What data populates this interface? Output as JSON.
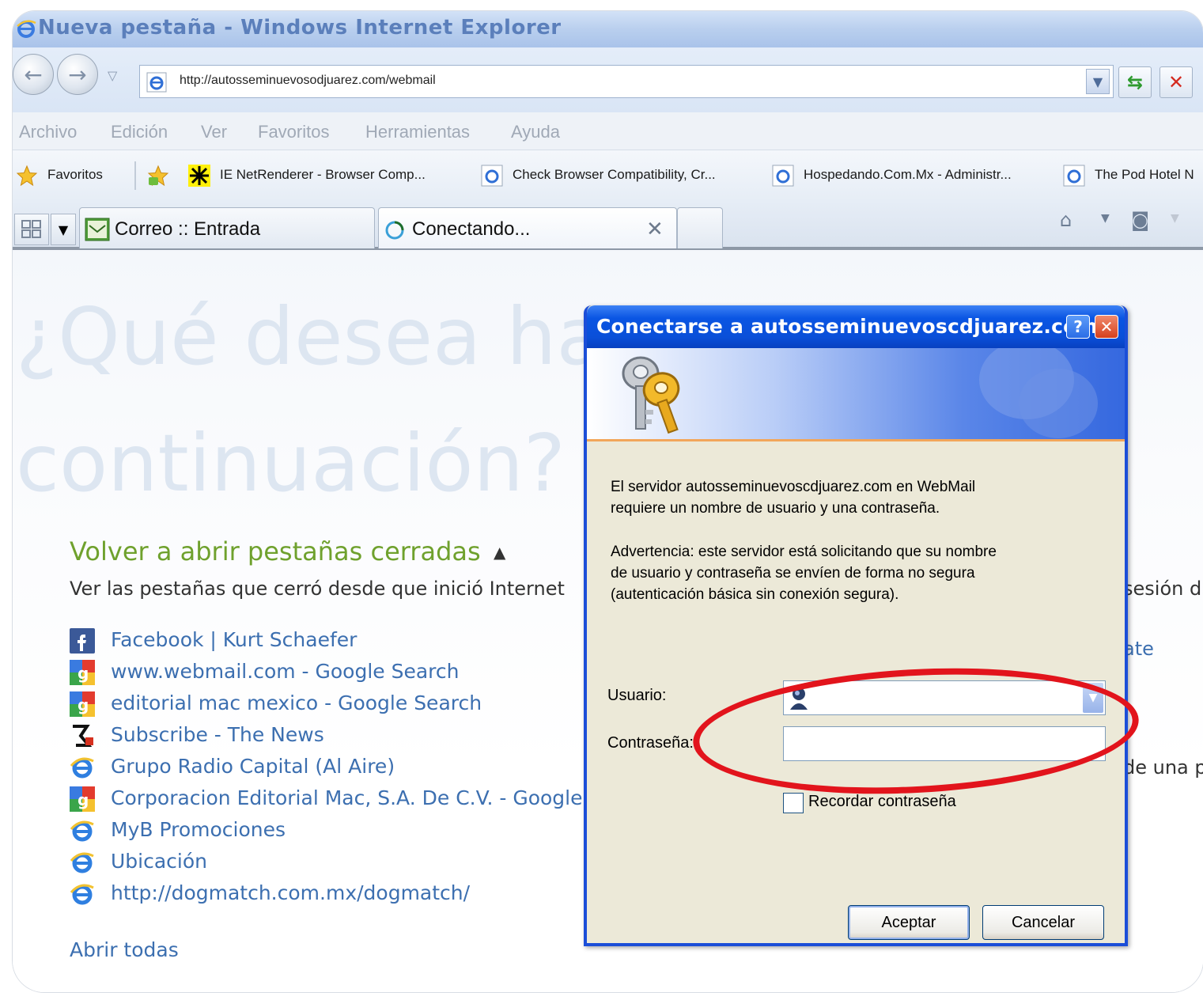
{
  "window": {
    "title": "Nueva pestaña - Windows Internet Explorer"
  },
  "address_bar": {
    "url": "http://autosseminuevosodjuarez.com/webmail",
    "refresh_icon": "refresh-icon",
    "stop_icon": "stop-icon"
  },
  "menu": {
    "items": [
      "Archivo",
      "Edición",
      "Ver",
      "Favoritos",
      "Herramientas",
      "Ayuda"
    ]
  },
  "favorites_bar": {
    "favorites_label": "Favoritos",
    "links": [
      "IE NetRenderer - Browser Comp...",
      "Check Browser Compatibility, Cr...",
      "Hospedando.Com.Mx - Administr...",
      "The Pod Hotel N"
    ]
  },
  "tabs": [
    {
      "label": "Correo :: Entrada"
    },
    {
      "label": "Conectando..."
    }
  ],
  "new_tab_page": {
    "heading": "¿Qué desea hacer a continuación?",
    "reopen_title": "Volver a abrir pestañas cerradas",
    "reopen_desc": "Ver las pestañas que cerró desde que inició Internet",
    "right_desc": "sesión d",
    "right_link": "ate",
    "right_text2": "de una p",
    "closed_tabs": [
      {
        "label": "Facebook | Kurt Schaefer",
        "icon": "facebook-icon"
      },
      {
        "label": "www.webmail.com - Google Search",
        "icon": "google-icon"
      },
      {
        "label": "editorial mac mexico - Google Search",
        "icon": "google-icon"
      },
      {
        "label": "Subscribe - The News",
        "icon": "feed-icon"
      },
      {
        "label": "Grupo Radio Capital (Al Aire)",
        "icon": "ie-icon"
      },
      {
        "label": "Corporacion Editorial Mac, S.A. De C.V. - Google",
        "icon": "google-icon"
      },
      {
        "label": "MyB Promociones",
        "icon": "ie-icon"
      },
      {
        "label": "Ubicación",
        "icon": "ie-icon"
      },
      {
        "label": "http://dogmatch.com.mx/dogmatch/",
        "icon": "ie-icon"
      }
    ],
    "open_all": "Abrir todas"
  },
  "dialog": {
    "title": "Conectarse a autosseminuevoscdjuarez.com",
    "help": "?",
    "close": "✕",
    "message1_line1": "El servidor autosseminuevoscdjuarez.com en WebMail",
    "message1_line2": "requiere un nombre de usuario y una contraseña.",
    "message2_line1": "Advertencia: este servidor está solicitando que su nombre",
    "message2_line2": "de usuario y contraseña se envíen de forma no segura",
    "message2_line3": "(autenticación básica sin conexión segura).",
    "user_label": "Usuario:",
    "user_value": "",
    "password_label": "Contraseña:",
    "password_value": "",
    "remember_label": "Recordar contraseña",
    "remember_checked": false,
    "ok_label": "Aceptar",
    "cancel_label": "Cancelar"
  },
  "colors": {
    "xp_blue": "#0a55e3",
    "annotation_ring": "#e2141c",
    "link": "#3c6fb0",
    "green_heading": "#6fa12d"
  }
}
